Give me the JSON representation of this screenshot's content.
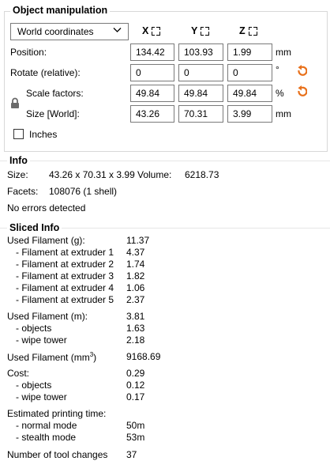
{
  "object_manipulation": {
    "title": "Object manipulation",
    "coord_select": "World coordinates",
    "axes": [
      "X",
      "Y",
      "Z"
    ],
    "position": {
      "label": "Position:",
      "x": "134.42",
      "y": "103.93",
      "z": "1.99",
      "unit": "mm"
    },
    "rotate": {
      "label": "Rotate (relative):",
      "x": "0",
      "y": "0",
      "z": "0",
      "unit": "°"
    },
    "scale": {
      "label": "Scale factors:",
      "x": "49.84",
      "y": "49.84",
      "z": "49.84",
      "unit": "%"
    },
    "size": {
      "label": "Size [World]:",
      "x": "43.26",
      "y": "70.31",
      "z": "3.99",
      "unit": "mm"
    },
    "inches_label": "Inches"
  },
  "info": {
    "title": "Info",
    "size_label": "Size:",
    "size_value": "43.26 x 70.31 x 3.99",
    "volume_label": "Volume:",
    "volume_value": "6218.73",
    "facets_label": "Facets:",
    "facets_value": "108076 (1 shell)",
    "errors": "No errors detected"
  },
  "sliced": {
    "title": "Sliced Info",
    "rows": [
      {
        "label": "Used Filament (g):",
        "value": "11.37"
      },
      {
        "label": "- Filament at extruder 1",
        "value": "4.37"
      },
      {
        "label": "- Filament at extruder 2",
        "value": "1.74"
      },
      {
        "label": "- Filament at extruder 3",
        "value": "1.82"
      },
      {
        "label": "- Filament at extruder 4",
        "value": "1.06"
      },
      {
        "label": "- Filament at extruder 5",
        "value": "2.37"
      },
      {
        "label": "Used Filament (m):",
        "value": "3.81"
      },
      {
        "label": "- objects",
        "value": "1.63"
      },
      {
        "label": "- wipe tower",
        "value": "2.18"
      },
      {
        "label": "Used Filament (mm",
        "label_sup": "3",
        "label_end": ")",
        "value": "9168.69"
      },
      {
        "label": "Cost:",
        "value": "0.29"
      },
      {
        "label": "- objects",
        "value": "0.12"
      },
      {
        "label": "- wipe tower",
        "value": "0.17"
      },
      {
        "label": "Estimated printing time:",
        "value": ""
      },
      {
        "label": "- normal mode",
        "value": "50m"
      },
      {
        "label": "- stealth mode",
        "value": "53m"
      },
      {
        "label": "Number of tool changes",
        "value": "37"
      }
    ]
  },
  "colors": {
    "reset_arrow": "#e8701a",
    "border": "#7a7a7a"
  },
  "icons": {
    "lock": "lock-icon",
    "reset": "undo-arrow-icon",
    "axis": "axis-square-icon",
    "dropdown": "chevron-down-icon"
  }
}
